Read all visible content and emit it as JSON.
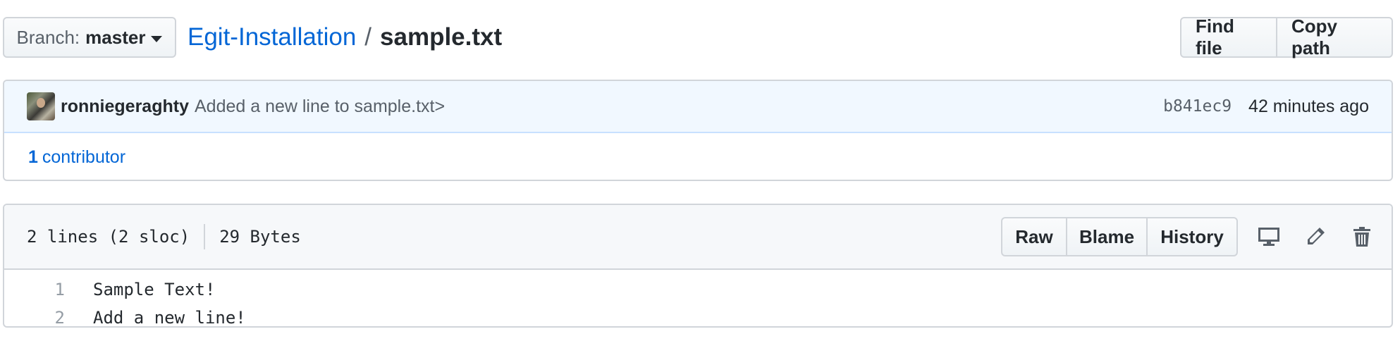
{
  "branch": {
    "label": "Branch:",
    "name": "master"
  },
  "breadcrumb": {
    "repo": "Egit-Installation",
    "separator": "/",
    "file": "sample.txt"
  },
  "file_nav": {
    "find_file": "Find file",
    "copy_path": "Copy path"
  },
  "commit": {
    "author": "ronniegeraghty",
    "message": "Added a new line to sample.txt>",
    "sha": "b841ec9",
    "time": "42 minutes ago"
  },
  "contributors": {
    "count": "1",
    "label": "contributor"
  },
  "file": {
    "lines_info": "2 lines (2 sloc)",
    "size": "29 Bytes",
    "raw": "Raw",
    "blame": "Blame",
    "history": "History",
    "icons": [
      "desktop-icon",
      "pencil-icon",
      "trash-icon"
    ],
    "code_lines": [
      {
        "number": "1",
        "text": "Sample Text!"
      },
      {
        "number": "2",
        "text": "Add a new line!"
      }
    ]
  },
  "colors": {
    "link": "#0366d6",
    "commit_bg": "#f1f8ff",
    "header_bg": "#f6f8fa",
    "border": "#d1d5da"
  }
}
